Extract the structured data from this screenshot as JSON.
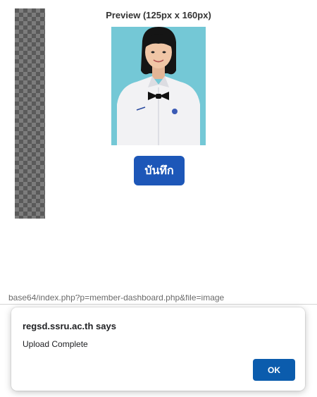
{
  "preview": {
    "title": "Preview (125px x 160px)"
  },
  "actions": {
    "save_label": "บันทึก"
  },
  "background": {
    "url_text": "base64/index.php?p=member-dashboard.php&file=image"
  },
  "dialog": {
    "title": "regsd.ssru.ac.th says",
    "message": "Upload Complete",
    "ok_label": "OK"
  },
  "colors": {
    "save_button": "#1d57b8",
    "ok_button": "#0b5cad",
    "photo_background": "#74c8d6"
  }
}
